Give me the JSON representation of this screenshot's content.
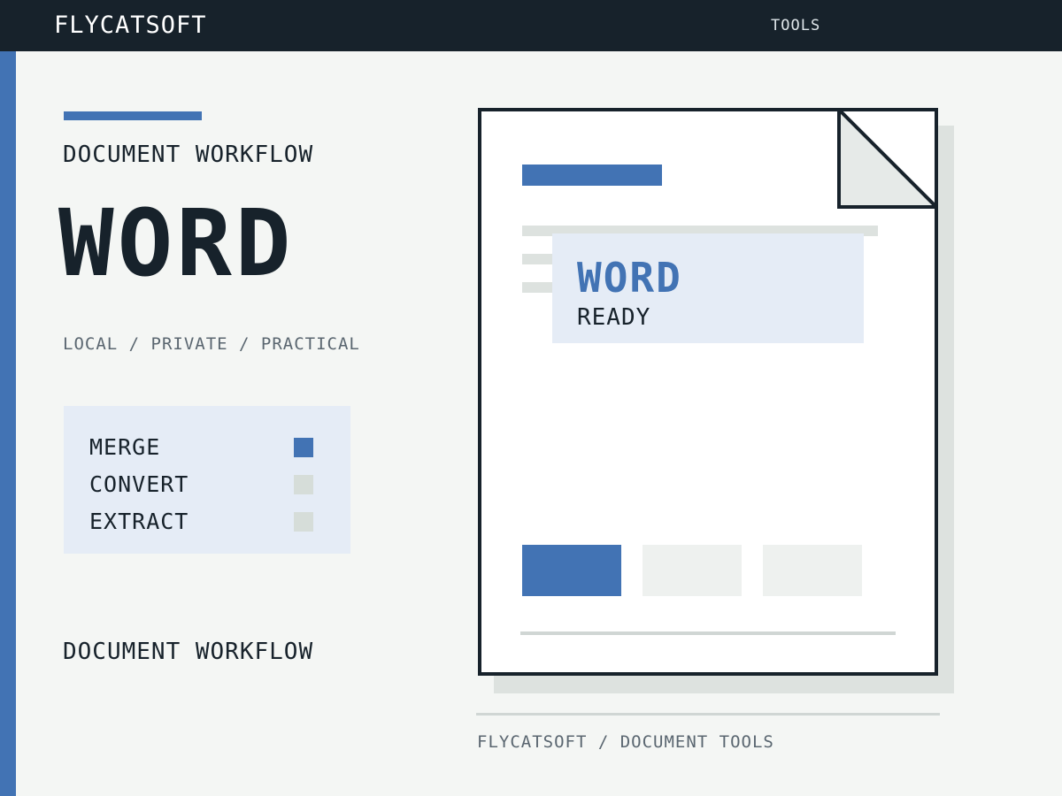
{
  "header": {
    "brand": "FLYCATSOFT",
    "nav_tools": "TOOLS"
  },
  "hero": {
    "eyebrow": "DOCUMENT WORKFLOW",
    "title": "WORD",
    "tagline": "LOCAL / PRIVATE / PRACTICAL"
  },
  "features": [
    {
      "label": "MERGE",
      "active": true
    },
    {
      "label": "CONVERT",
      "active": false
    },
    {
      "label": "EXTRACT",
      "active": false
    }
  ],
  "footer_eyebrow": "DOCUMENT WORKFLOW",
  "document": {
    "card_title": "WORD",
    "card_status": "READY"
  },
  "footer_caption": "FLYCATSOFT / DOCUMENT TOOLS",
  "colors": {
    "accent": "#4273b4",
    "dark": "#17222b",
    "background": "#f4f6f4",
    "panel": "#e5ecf6",
    "inactive": "#d6ddd9"
  }
}
